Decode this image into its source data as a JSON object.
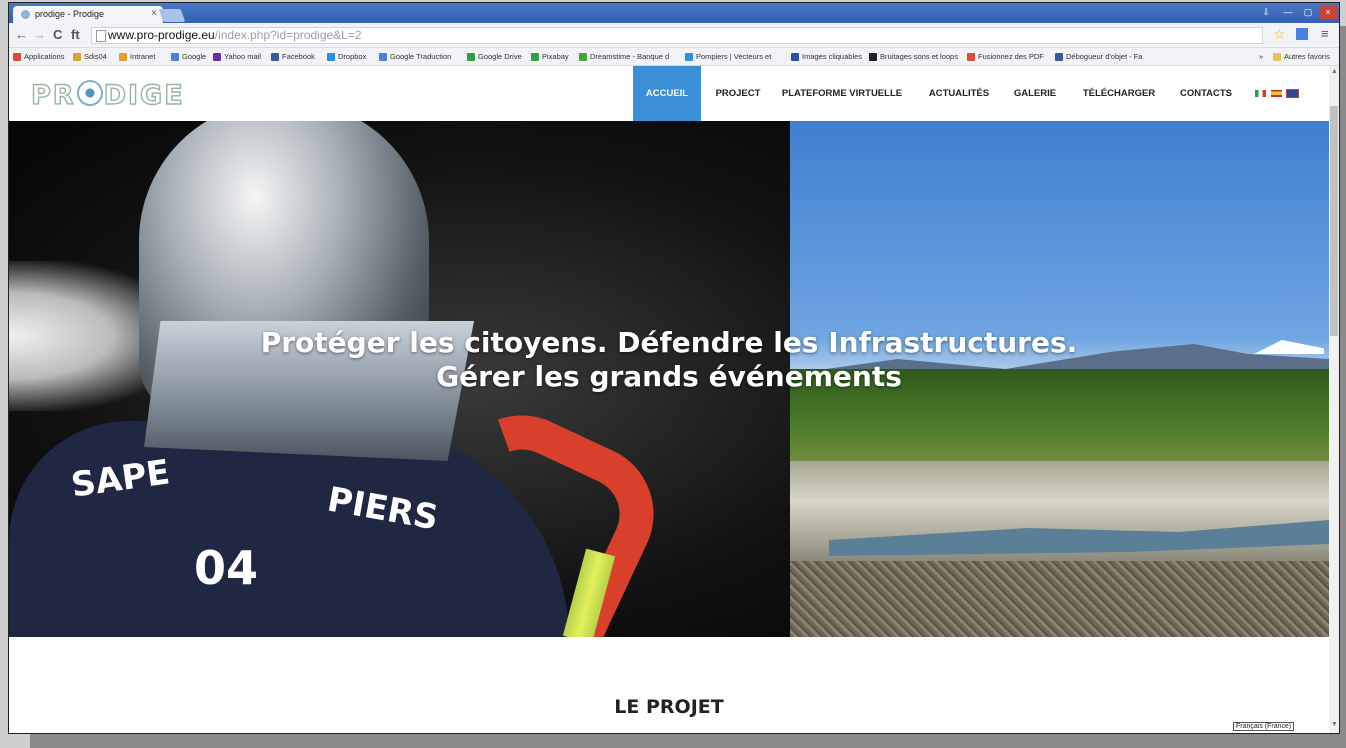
{
  "browser": {
    "tab_title": "prodige - Prodige",
    "tab_close": "×",
    "url_host": "www.pro-prodige.eu",
    "url_path": "/index.php?id=prodige&L=2",
    "nav_back": "←",
    "nav_forward": "→",
    "nav_reload": "C",
    "nav_home": "ft",
    "menu_glyph": "≡",
    "star_glyph": "☆",
    "window_controls": [
      "⇩",
      "—",
      "▢",
      "×"
    ],
    "bookmarks": [
      {
        "label": "Applications",
        "color": "#e04a3a"
      },
      {
        "label": "Sdis04",
        "color": "#e0a030"
      },
      {
        "label": "Intranet",
        "color": "#e0a030"
      },
      {
        "label": "Google",
        "color": "#4a80e0"
      },
      {
        "label": "Yahoo mail",
        "color": "#6a2fa8"
      },
      {
        "label": "Facebook",
        "color": "#3b5998"
      },
      {
        "label": "Dropbox",
        "color": "#2d8fe0"
      },
      {
        "label": "Google Traduction",
        "color": "#4a80e0"
      },
      {
        "label": "Google Drive",
        "color": "#2fa04a"
      },
      {
        "label": "Pixabay",
        "color": "#2fa04a"
      },
      {
        "label": "Dreamstime - Banque d",
        "color": "#4aa040"
      },
      {
        "label": "Pompiers | Vecteurs et",
        "color": "#2d8fe0"
      },
      {
        "label": "Images cliquables",
        "color": "#2d4fa0"
      },
      {
        "label": "Bruitages sons et loops",
        "color": "#222222"
      },
      {
        "label": "Fusionnez des PDF",
        "color": "#e04a3a"
      },
      {
        "label": "Débogueur d'objet - Fa",
        "color": "#3b5998"
      }
    ],
    "bookmarks_more": "»",
    "other_bookmarks": "Autres favoris"
  },
  "site": {
    "logo": {
      "part1": "PR",
      "part2": "DIGE"
    },
    "nav": [
      {
        "label": "ACCUEIL",
        "active": true
      },
      {
        "label": "PROJECT",
        "active": false
      },
      {
        "label": "PLATEFORME VIRTUELLE",
        "active": false
      },
      {
        "label": "ACTUALITÉS",
        "active": false
      },
      {
        "label": "GALERIE",
        "active": false
      },
      {
        "label": "TÉLÉCHARGER",
        "active": false
      },
      {
        "label": "CONTACTS",
        "active": false
      }
    ],
    "languages": [
      "it",
      "es",
      "en"
    ],
    "hero": {
      "line1": "Protéger les citoyens. Défendre les Infrastructures.",
      "line2": "Gérer les grands événements",
      "shirt_text1": "SAPE",
      "shirt_text2": "PIERS",
      "shirt_number": "04"
    },
    "section_title": "LE PROJET"
  },
  "tooltip": "Français (France)"
}
